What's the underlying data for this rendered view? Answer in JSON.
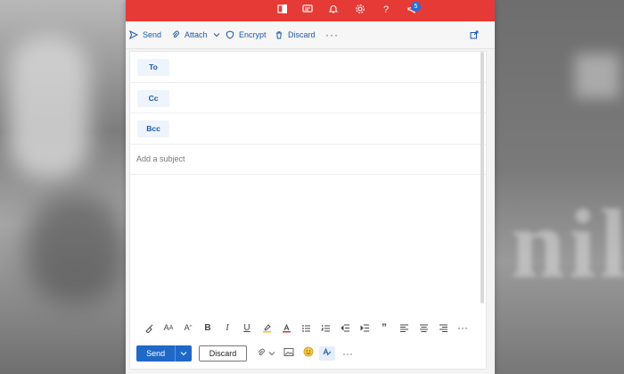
{
  "toolbar": {
    "send_label": "Send",
    "attach_label": "Attach",
    "encrypt_label": "Encrypt",
    "discard_label": "Discard",
    "more_label": "···"
  },
  "header": {
    "notification_count": "5",
    "accent_color": "#e63a36"
  },
  "fields": {
    "to_label": "To",
    "cc_label": "Cc",
    "bcc_label": "Bcc",
    "subject_placeholder": "Add a subject"
  },
  "formatting": {
    "more_label": "···"
  },
  "actions": {
    "send_label": "Send",
    "discard_label": "Discard",
    "more_label": "···"
  },
  "icons": [
    "office-icon",
    "teams-icon",
    "bell-icon",
    "gear-icon",
    "help-icon",
    "megaphone-icon",
    "send-icon",
    "paperclip-icon",
    "chevron-down-icon",
    "shield-icon",
    "trash-icon",
    "popout-icon",
    "format-painter-icon",
    "font-size-icon",
    "grow-font-icon",
    "bold-icon",
    "italic-icon",
    "underline-icon",
    "highlight-icon",
    "font-color-icon",
    "bullets-icon",
    "numbering-icon",
    "outdent-icon",
    "indent-icon",
    "quote-icon",
    "align-left-icon",
    "align-center-icon",
    "align-right-icon",
    "image-icon",
    "emoji-icon",
    "editor-icon"
  ]
}
